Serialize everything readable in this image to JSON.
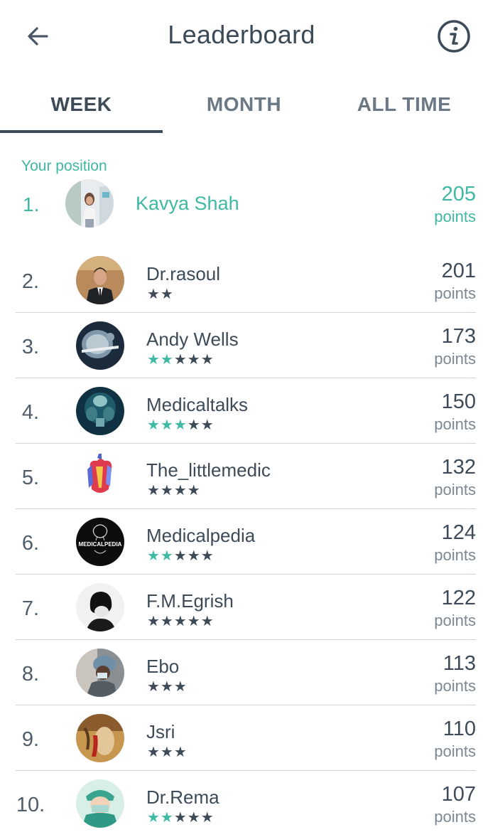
{
  "header": {
    "title": "Leaderboard",
    "back_icon": "arrow-left-icon",
    "info_icon": "info-icon"
  },
  "tabs": [
    {
      "label": "WEEK",
      "active": true
    },
    {
      "label": "MONTH",
      "active": false
    },
    {
      "label": "ALL TIME",
      "active": false
    }
  ],
  "colors": {
    "accent": "#3fb8a4",
    "text": "#3d4b59",
    "muted": "#7b8792",
    "divider": "#cfd5da"
  },
  "my_position": {
    "label": "Your position",
    "rank": "1.",
    "name": "Kavya Shah",
    "points": "205",
    "points_label": "points"
  },
  "leaderboard": [
    {
      "rank": "2.",
      "name": "Dr.rasoul",
      "points": "201",
      "points_label": "points",
      "stars_filled": 0,
      "stars_total": 2
    },
    {
      "rank": "3.",
      "name": "Andy Wells",
      "points": "173",
      "points_label": "points",
      "stars_filled": 2,
      "stars_total": 5
    },
    {
      "rank": "4.",
      "name": "Medicaltalks",
      "points": "150",
      "points_label": "points",
      "stars_filled": 3,
      "stars_total": 5
    },
    {
      "rank": "5.",
      "name": "The_littlemedic",
      "points": "132",
      "points_label": "points",
      "stars_filled": 0,
      "stars_total": 4
    },
    {
      "rank": "6.",
      "name": "Medicalpedia",
      "points": "124",
      "points_label": "points",
      "stars_filled": 2,
      "stars_total": 5,
      "avatar_text": "MEDICALPEDIA"
    },
    {
      "rank": "7.",
      "name": "F.M.Egrish",
      "points": "122",
      "points_label": "points",
      "stars_filled": 0,
      "stars_total": 5
    },
    {
      "rank": "8.",
      "name": "Ebo",
      "points": "113",
      "points_label": "points",
      "stars_filled": 0,
      "stars_total": 3
    },
    {
      "rank": "9.",
      "name": "Jsri",
      "points": "110",
      "points_label": "points",
      "stars_filled": 0,
      "stars_total": 3
    },
    {
      "rank": "10.",
      "name": "Dr.Rema",
      "points": "107",
      "points_label": "points",
      "stars_filled": 2,
      "stars_total": 5
    }
  ]
}
